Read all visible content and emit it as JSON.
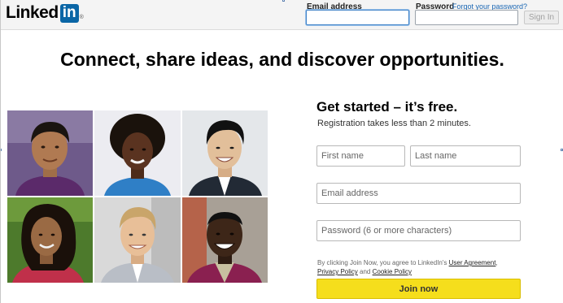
{
  "header": {
    "logo_text": "Linked",
    "logo_box": "in",
    "logo_reg": "®",
    "email_label": "Email address",
    "password_label": "Password",
    "forgot_link": "Forgot your password?",
    "signin_label": "Sign In",
    "email_value": "",
    "password_value": ""
  },
  "hero": {
    "headline": "Connect, share ideas, and discover opportunities."
  },
  "photos": [
    {
      "name": "member-photo-1",
      "bg": "#6e5a8a",
      "skin": "#b07a52",
      "hair": "#1a1410",
      "shirt": "#5b2a6a"
    },
    {
      "name": "member-photo-2",
      "bg": "#e9e9ee",
      "skin": "#5a3320",
      "hair": "#1a120c",
      "shirt": "#2f7fc6"
    },
    {
      "name": "member-photo-3",
      "bg": "#e4e7ea",
      "skin": "#e2bf9a",
      "hair": "#111111",
      "shirt": "#222a35"
    },
    {
      "name": "member-photo-4",
      "bg": "#4d7a2c",
      "skin": "#9a6a44",
      "hair": "#1a100a",
      "shirt": "#c0304a"
    },
    {
      "name": "member-photo-5",
      "bg": "#d9d9d9",
      "skin": "#e8bf98",
      "hair": "#c9a56a",
      "shirt": "#b9bec6"
    },
    {
      "name": "member-photo-6",
      "bg": "#a8a096",
      "skin": "#3d2618",
      "hair": "#111",
      "shirt": "#8a2050"
    }
  ],
  "signup": {
    "title": "Get started – it’s free.",
    "subtitle": "Registration takes less than 2 minutes.",
    "first_name_placeholder": "First name",
    "last_name_placeholder": "Last name",
    "email_placeholder": "Email address",
    "password_placeholder": "Password (6 or more characters)",
    "terms_prefix": "By clicking Join Now, you agree to LinkedIn's ",
    "terms_user_agreement": "User Agreement",
    "terms_comma": ",",
    "terms_privacy": "Privacy Policy",
    "terms_and": " and ",
    "terms_cookie": "Cookie Policy",
    "join_label": "Join now"
  },
  "colors": {
    "brand_blue": "#0a66a6",
    "join_yellow": "#f5de1c",
    "link_blue": "#1a66b3"
  }
}
